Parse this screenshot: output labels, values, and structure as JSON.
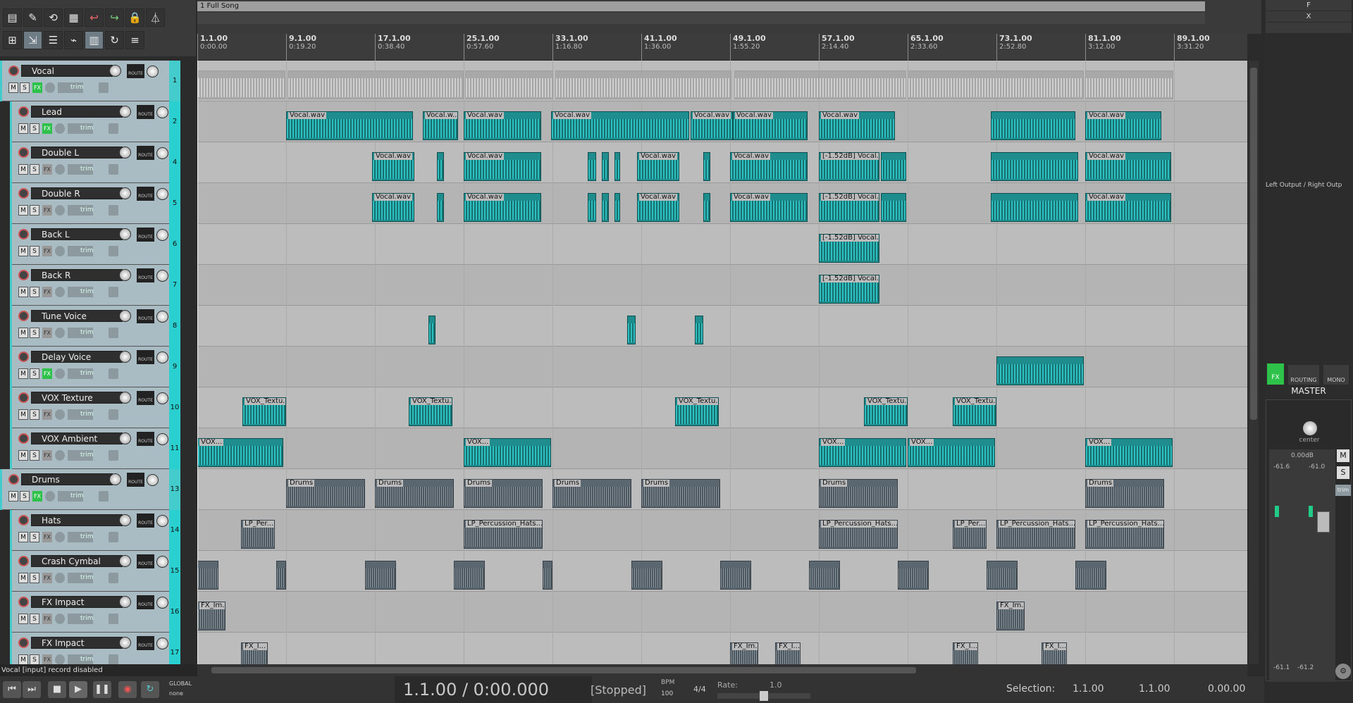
{
  "region": {
    "name": "1  Full Song"
  },
  "ruler": [
    {
      "bar": "1.1.00",
      "time": "0:00.00"
    },
    {
      "bar": "9.1.00",
      "time": "0:19.20"
    },
    {
      "bar": "17.1.00",
      "time": "0:38.40"
    },
    {
      "bar": "25.1.00",
      "time": "0:57.60"
    },
    {
      "bar": "33.1.00",
      "time": "1:16.80"
    },
    {
      "bar": "41.1.00",
      "time": "1:36.00"
    },
    {
      "bar": "49.1.00",
      "time": "1:55.20"
    },
    {
      "bar": "57.1.00",
      "time": "2:14.40"
    },
    {
      "bar": "65.1.00",
      "time": "2:33.60"
    },
    {
      "bar": "73.1.00",
      "time": "2:52.80"
    },
    {
      "bar": "81.1.00",
      "time": "3:12.00"
    },
    {
      "bar": "89.1.00",
      "time": "3:31.20"
    }
  ],
  "tracks": [
    {
      "name": "Vocal",
      "num": "1",
      "folder": true,
      "fx_on": true
    },
    {
      "name": "Lead",
      "num": "2",
      "fx_on": true
    },
    {
      "name": "Double L",
      "num": "4",
      "fx_on": false
    },
    {
      "name": "Double R",
      "num": "5",
      "fx_on": false
    },
    {
      "name": "Back L",
      "num": "6",
      "fx_on": false
    },
    {
      "name": "Back R",
      "num": "7",
      "fx_on": false
    },
    {
      "name": "Tune Voice",
      "num": "8",
      "fx_on": false
    },
    {
      "name": "Delay Voice",
      "num": "9",
      "fx_on": true
    },
    {
      "name": "VOX Texture",
      "num": "10",
      "fx_on": false
    },
    {
      "name": "VOX Ambient",
      "num": "11",
      "fx_on": false
    },
    {
      "name": "Drums",
      "num": "13",
      "folder": true,
      "fx_on": true
    },
    {
      "name": "Hats",
      "num": "14",
      "fx_on": false
    },
    {
      "name": "Crash Cymbal",
      "num": "15",
      "fx_on": false
    },
    {
      "name": "FX Impact",
      "num": "16",
      "fx_on": false
    },
    {
      "name": "FX Impact",
      "num": "17",
      "fx_on": false
    }
  ],
  "labels": {
    "m": "M",
    "s": "S",
    "fx": "FX",
    "trim": "trim",
    "route": "ROUTE"
  },
  "items": {
    "vocal": "Vocal.wav",
    "vocal_short": "Vocal.w...",
    "gain": "[-1.52dB] Vocal...",
    "texture": "VOX_Textu...",
    "ambient": "VOX...",
    "drums": "Drums",
    "hats": "LP_Percussion_Hats....",
    "hats_short": "LP_Per...",
    "fx_im": "FX_Im...",
    "fx_i": "FX_I..."
  },
  "master": {
    "fx": "FX",
    "output": "Left Output / Right Outp",
    "title": "MASTER",
    "pan": "center",
    "vol": "0.00dB",
    "peakL": "-61.6",
    "peakR": "-61.0",
    "bottomL": "-61.1",
    "bottomR": "-61.2",
    "routing": "ROUTING",
    "mono": "MONO",
    "m": "M",
    "s": "S",
    "trim": "trim"
  },
  "transport": {
    "status_line": "Vocal [input] record disabled",
    "global": "GLOBAL",
    "none": "none",
    "position": "1.1.00 / 0:00.000",
    "state": "[Stopped]",
    "bpm_label": "BPM",
    "bpm": "100",
    "timesig": "4/4",
    "rate_label": "Rate:",
    "rate": "1.0",
    "selection_label": "Selection:",
    "sel_start": "1.1.00",
    "sel_end": "1.1.00",
    "sel_len": "0.00.00"
  }
}
